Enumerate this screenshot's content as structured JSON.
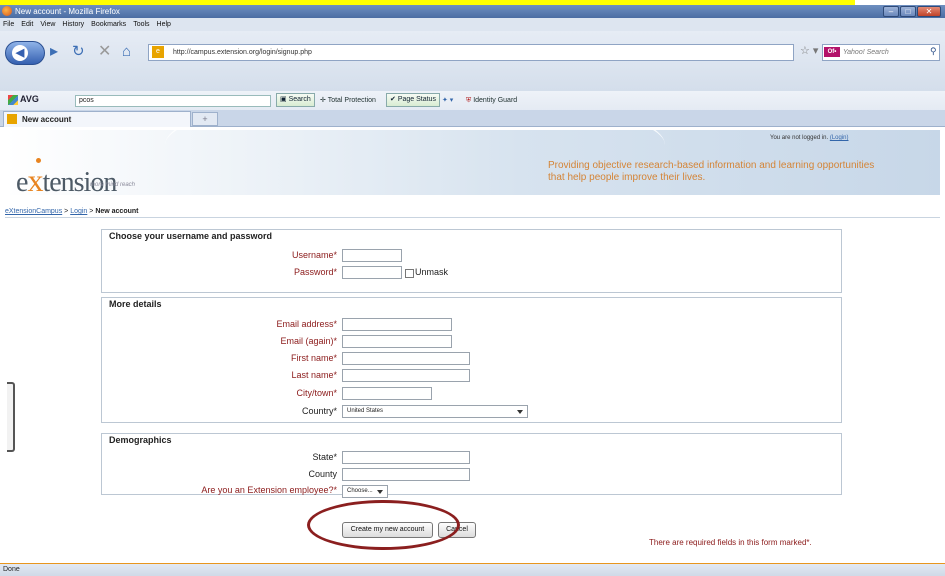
{
  "window": {
    "title": "New account - Mozilla Firefox",
    "buttons": [
      "–",
      "□",
      "✕"
    ]
  },
  "menu": [
    "File",
    "Edit",
    "View",
    "History",
    "Bookmarks",
    "Tools",
    "Help"
  ],
  "nav": {
    "url": "http://campus.extension.org/login/signup.php",
    "search_placeholder": "Yahoo! Search",
    "search_badge": "Of•"
  },
  "avg": {
    "logo": "AVG",
    "query": "pcos",
    "search_btn": "Search",
    "total_protection": "Total Protection",
    "page_status": "Page Status",
    "identity_guard": "Identity Guard"
  },
  "tab": {
    "label": "New account",
    "new_tab": "+"
  },
  "site": {
    "logo_pre": "e",
    "logo_x": "x",
    "logo_post": "tension",
    "logo_sub": "more mind reach",
    "login_note_text": "You are not logged in. ",
    "login_link": "(Login)",
    "tagline": "Providing objective research-based information and learning opportunities that help people improve their lives."
  },
  "breadcrumb": {
    "home": "eXtensionCampus",
    "sep1": " > ",
    "login": "Login",
    "sep2": " > ",
    "current": "New account"
  },
  "form": {
    "section1": {
      "title": "Choose your username and password",
      "username_label": "Username*",
      "password_label": "Password*",
      "unmask_label": "Unmask"
    },
    "section2": {
      "title": "More details",
      "email_label": "Email address*",
      "email2_label": "Email (again)*",
      "firstname_label": "First name*",
      "lastname_label": "Last name*",
      "city_label": "City/town*",
      "country_label": "Country*",
      "country_value": "United States"
    },
    "section3": {
      "title": "Demographics",
      "state_label": "State*",
      "county_label": "County",
      "employee_label": "Are you an Extension employee?*",
      "employee_value": "Choose..."
    },
    "create_button": "Create my new account",
    "cancel_button": "Cancel",
    "required_note": "There are required fields in this form marked*."
  },
  "status": {
    "text": "Done"
  }
}
